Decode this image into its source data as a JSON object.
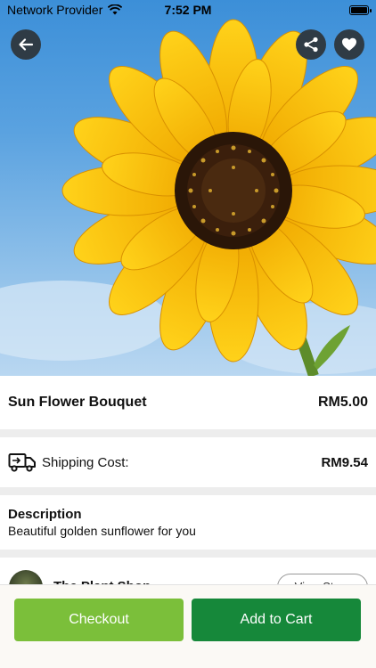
{
  "status_bar": {
    "carrier": "Network Provider",
    "time": "7:52 PM"
  },
  "header": {
    "back_icon": "arrow-left-icon",
    "share_icon": "share-icon",
    "favorite_icon": "heart-icon"
  },
  "product": {
    "name": "Sun Flower Bouquet",
    "price": "RM5.00"
  },
  "shipping": {
    "icon": "truck-icon",
    "label": "Shipping Cost:",
    "value": "RM9.54"
  },
  "description": {
    "heading": "Description",
    "text": "Beautiful golden sunflower for you"
  },
  "store": {
    "name": "The Plant Shop",
    "view_label": "View Store"
  },
  "actions": {
    "checkout_label": "Checkout",
    "add_to_cart_label": "Add to Cart"
  },
  "colors": {
    "checkout": "#7bbf3a",
    "add_to_cart": "#16883a",
    "icon_button_bg": "#2f3b45"
  }
}
